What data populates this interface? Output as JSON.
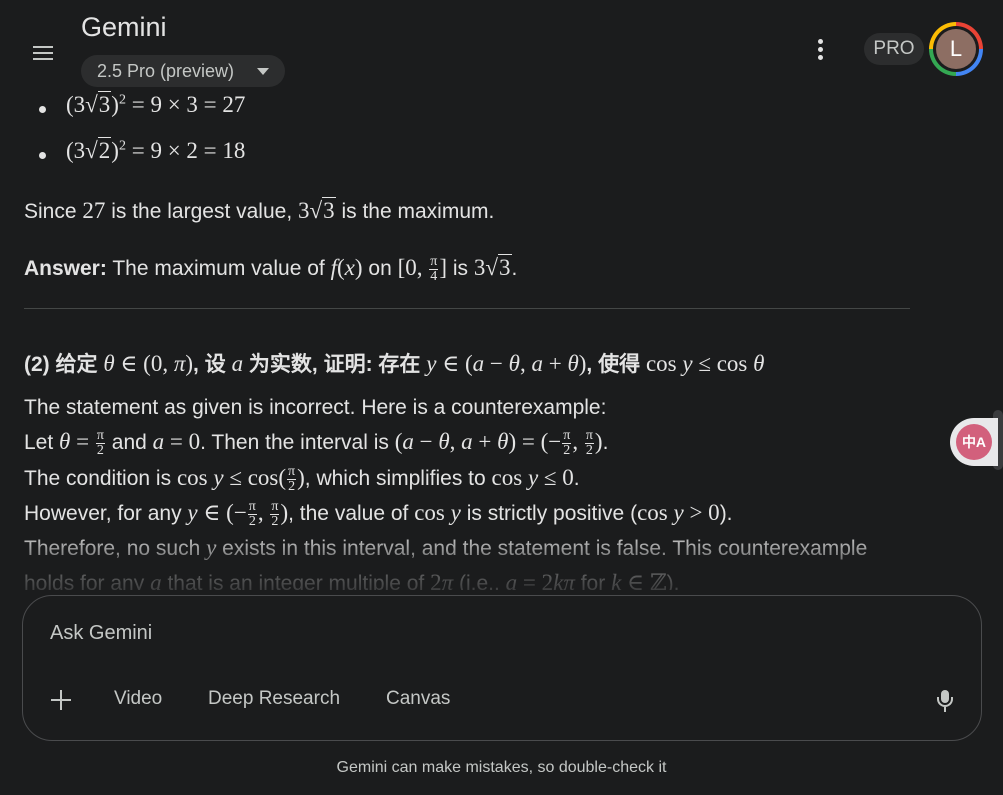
{
  "header": {
    "app_title": "Gemini",
    "model_label": "2.5 Pro (preview)",
    "pro_badge": "PRO",
    "avatar_initial": "L"
  },
  "content": {
    "bullet1_lhs": "(3√3)² = 9 × 3 = 27",
    "bullet2_lhs": "(3√2)² = 9 × 2 = 18",
    "since_text_1": "Since",
    "since_value": "27",
    "since_text_2": "is the largest value,",
    "since_text_3": "is the maximum.",
    "answer_label": "Answer:",
    "answer_text_1": "The maximum value of",
    "answer_text_2": "on",
    "answer_text_3": "is",
    "question_2_prefix": "(2) 给定",
    "question_2_mid1": ", 设",
    "question_2_mid2": "为实数, 证明: 存在",
    "question_2_mid3": ", 使得",
    "stmt_line": "The statement as given is incorrect. Here is a counterexample:",
    "let_text_1": "Let",
    "let_text_2": "and",
    "let_text_3": ". Then the interval is",
    "cond_text_1": "The condition is",
    "cond_text_2": ", which simplifies to",
    "however_text_1": "However, for any",
    "however_text_2": ", the value of",
    "however_text_3": "is strictly positive (",
    "therefore_text_1": "Therefore, no such",
    "therefore_text_2": "exists in this interval, and the statement is false. This counterexample",
    "holds_text_1": "holds for any",
    "holds_text_2": "that is an integer multiple of",
    "holds_text_3": "(i.e.,",
    "holds_text_4": "for",
    "holds_text_5": ")."
  },
  "input": {
    "placeholder": "Ask Gemini",
    "tools": [
      "Video",
      "Deep Research",
      "Canvas"
    ]
  },
  "footer": {
    "disclaimer": "Gemini can make mistakes, so double-check it"
  },
  "icons": {
    "menu": "hamburger-menu-icon",
    "more": "vertical-dots-icon",
    "add": "plus-icon",
    "mic": "microphone-icon",
    "translate": "translate-icon"
  }
}
